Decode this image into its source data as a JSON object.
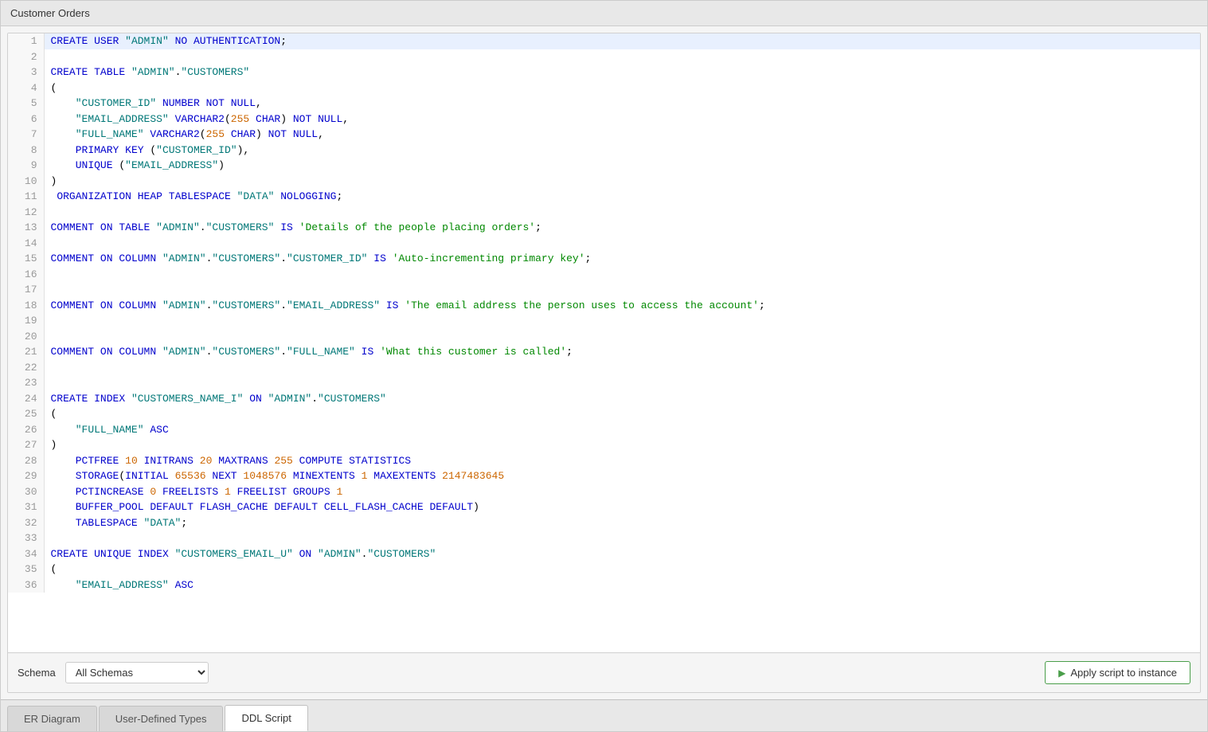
{
  "window": {
    "title": "Customer Orders"
  },
  "tabs": [
    {
      "id": "er-diagram",
      "label": "ER Diagram",
      "active": false
    },
    {
      "id": "user-defined-types",
      "label": "User-Defined Types",
      "active": false
    },
    {
      "id": "ddl-script",
      "label": "DDL Script",
      "active": true
    }
  ],
  "bottom": {
    "schema_label": "Schema",
    "schema_placeholder": "All Schemas",
    "apply_button": "Apply script to instance"
  },
  "code_lines": [
    {
      "num": 1,
      "content": "CREATE USER \"ADMIN\" NO AUTHENTICATION;",
      "highlighted": true
    },
    {
      "num": 2,
      "content": ""
    },
    {
      "num": 3,
      "content": "CREATE TABLE \"ADMIN\".\"CUSTOMERS\""
    },
    {
      "num": 4,
      "content": "("
    },
    {
      "num": 5,
      "content": "    \"CUSTOMER_ID\" NUMBER NOT NULL,"
    },
    {
      "num": 6,
      "content": "    \"EMAIL_ADDRESS\" VARCHAR2(255 CHAR) NOT NULL,"
    },
    {
      "num": 7,
      "content": "    \"FULL_NAME\" VARCHAR2(255 CHAR) NOT NULL,"
    },
    {
      "num": 8,
      "content": "    PRIMARY KEY (\"CUSTOMER_ID\"),"
    },
    {
      "num": 9,
      "content": "    UNIQUE (\"EMAIL_ADDRESS\")"
    },
    {
      "num": 10,
      "content": ")"
    },
    {
      "num": 11,
      "content": " ORGANIZATION HEAP TABLESPACE \"DATA\" NOLOGGING;"
    },
    {
      "num": 12,
      "content": ""
    },
    {
      "num": 13,
      "content": "COMMENT ON TABLE \"ADMIN\".\"CUSTOMERS\" IS 'Details of the people placing orders';"
    },
    {
      "num": 14,
      "content": ""
    },
    {
      "num": 15,
      "content": "COMMENT ON COLUMN \"ADMIN\".\"CUSTOMERS\".\"CUSTOMER_ID\" IS 'Auto-incrementing primary key';"
    },
    {
      "num": 16,
      "content": ""
    },
    {
      "num": 17,
      "content": ""
    },
    {
      "num": 18,
      "content": "COMMENT ON COLUMN \"ADMIN\".\"CUSTOMERS\".\"EMAIL_ADDRESS\" IS 'The email address the person uses to access the account';"
    },
    {
      "num": 19,
      "content": ""
    },
    {
      "num": 20,
      "content": ""
    },
    {
      "num": 21,
      "content": "COMMENT ON COLUMN \"ADMIN\".\"CUSTOMERS\".\"FULL_NAME\" IS 'What this customer is called';"
    },
    {
      "num": 22,
      "content": ""
    },
    {
      "num": 23,
      "content": ""
    },
    {
      "num": 24,
      "content": "CREATE INDEX \"CUSTOMERS_NAME_I\" ON \"ADMIN\".\"CUSTOMERS\""
    },
    {
      "num": 25,
      "content": "("
    },
    {
      "num": 26,
      "content": "    \"FULL_NAME\" ASC"
    },
    {
      "num": 27,
      "content": ")"
    },
    {
      "num": 28,
      "content": "    PCTFREE 10 INITRANS 20 MAXTRANS 255 COMPUTE STATISTICS"
    },
    {
      "num": 29,
      "content": "    STORAGE(INITIAL 65536 NEXT 1048576 MINEXTENTS 1 MAXEXTENTS 2147483645"
    },
    {
      "num": 30,
      "content": "    PCTINCREASE 0 FREELISTS 1 FREELIST GROUPS 1"
    },
    {
      "num": 31,
      "content": "    BUFFER_POOL DEFAULT FLASH_CACHE DEFAULT CELL_FLASH_CACHE DEFAULT)"
    },
    {
      "num": 32,
      "content": "    TABLESPACE \"DATA\";"
    },
    {
      "num": 33,
      "content": ""
    },
    {
      "num": 34,
      "content": "CREATE UNIQUE INDEX \"CUSTOMERS_EMAIL_U\" ON \"ADMIN\".\"CUSTOMERS\""
    },
    {
      "num": 35,
      "content": "("
    },
    {
      "num": 36,
      "content": "    \"EMAIL_ADDRESS\" ASC"
    }
  ]
}
